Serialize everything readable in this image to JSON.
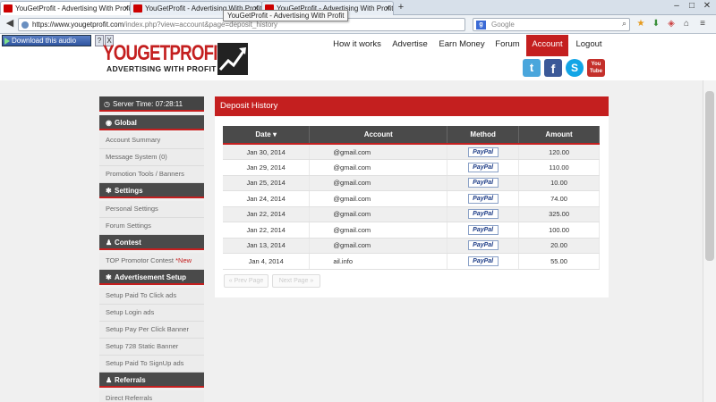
{
  "browser": {
    "tabs": [
      {
        "title": "YouGetProfit - Advertising With Profit",
        "close": "×"
      },
      {
        "title": "YouGetProfit - Advertising With Profit",
        "close": "×"
      },
      {
        "title": "YouGetProfit - Advertising With Profit",
        "close": "×"
      }
    ],
    "new_tab": "+",
    "tooltip": "YouGetProfit - Advertising With Profit",
    "url_host": "https://www.yougetprofit.com",
    "url_path": "/index.php?view=account&page=deposit_history",
    "search_placeholder": "Google",
    "download_label": "Download this audio",
    "download_help": "?",
    "download_close": "X",
    "win_minimize": "–",
    "win_maximize": "□",
    "win_close": "✕"
  },
  "site": {
    "logo_main": "YOUGETPROFIT",
    "logo_sub": "ADVERTISING WITH PROFIT",
    "nav": [
      {
        "label": "How it works",
        "active": false
      },
      {
        "label": "Advertise",
        "active": false
      },
      {
        "label": "Earn Money",
        "active": false
      },
      {
        "label": "Forum",
        "active": false
      },
      {
        "label": "Account",
        "active": true
      },
      {
        "label": "Logout",
        "active": false
      }
    ],
    "social": {
      "twitter": "t",
      "facebook": "f",
      "skype": "S",
      "youtube_top": "You",
      "youtube_bottom": "Tube"
    },
    "accent_color": "#c41f1f"
  },
  "sidebar": {
    "server_time": "Server Time: 07:28:11",
    "sections": [
      {
        "title": "Global",
        "items": [
          "Account Summary",
          "Message System (0)",
          "Promotion Tools / Banners"
        ]
      },
      {
        "title": "Settings",
        "items": [
          "Personal Settings",
          "Forum Settings"
        ]
      },
      {
        "title": "Contest",
        "items": [
          "TOP Promotor Contest"
        ]
      },
      {
        "title": "Advertisement Setup",
        "items": [
          "Setup Paid To Click ads",
          "Setup Login ads",
          "Setup Pay Per Click Banner",
          "Setup 728 Static Banner",
          "Setup Paid To SignUp ads"
        ]
      },
      {
        "title": "Referrals",
        "items": [
          "Direct Referrals"
        ]
      }
    ],
    "new_tag": "*New"
  },
  "main": {
    "panel_title": "Deposit History",
    "columns": [
      "Date ▾",
      "Account",
      "Method",
      "Amount"
    ],
    "rows": [
      {
        "date": "Jan 30, 2014",
        "account": "@gmail.com",
        "method": "PayPal",
        "amount": "120.00"
      },
      {
        "date": "Jan 29, 2014",
        "account": "@gmail.com",
        "method": "PayPal",
        "amount": "110.00"
      },
      {
        "date": "Jan 25, 2014",
        "account": "@gmail.com",
        "method": "PayPal",
        "amount": "10.00"
      },
      {
        "date": "Jan 24, 2014",
        "account": "@gmail.com",
        "method": "PayPal",
        "amount": "74.00"
      },
      {
        "date": "Jan 22, 2014",
        "account": "@gmail.com",
        "method": "PayPal",
        "amount": "325.00"
      },
      {
        "date": "Jan 22, 2014",
        "account": "@gmail.com",
        "method": "PayPal",
        "amount": "100.00"
      },
      {
        "date": "Jan 13, 2014",
        "account": "@gmail.com",
        "method": "PayPal",
        "amount": "20.00"
      },
      {
        "date": "Jan 4, 2014",
        "account": "ail.info",
        "method": "PayPal",
        "amount": "55.00"
      }
    ],
    "prev_page": "« Prev Page",
    "next_page": "Next Page »"
  }
}
